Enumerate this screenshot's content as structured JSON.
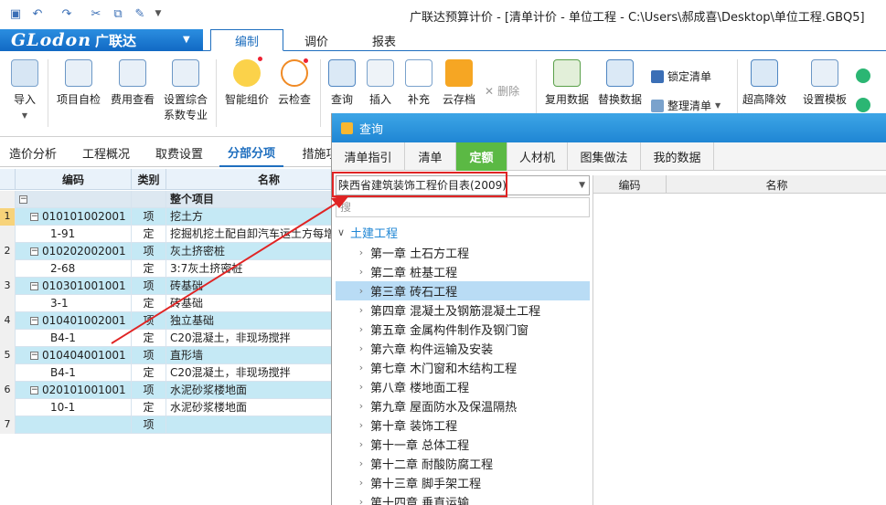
{
  "window": {
    "title": "广联达预算计价 - [清单计价 - 单位工程 - C:\\Users\\郝成喜\\Desktop\\单位工程.GBQ5]"
  },
  "logo": {
    "brand": "GLodon",
    "cn": "广联达"
  },
  "menu": {
    "tabs": [
      "编制",
      "调价",
      "报表"
    ],
    "active": 0
  },
  "ribbon": {
    "buttons": [
      "导入",
      "项目自检",
      "费用查看",
      "设置综合",
      "智能组价",
      "云检查",
      "查询",
      "插入",
      "补充",
      "云存档",
      "复用数据",
      "替换数据",
      "超高降效",
      "设置模板"
    ],
    "btn_second_line": {
      "set_compound": "系数专业"
    },
    "small": {
      "delete": "删除",
      "lock": "锁定清单",
      "organize": "整理清单"
    }
  },
  "left": {
    "tabs": [
      "造价分析",
      "工程概况",
      "取费设置",
      "分部分项",
      "措施项"
    ],
    "active_tab": 3,
    "columns": [
      "编码",
      "类别",
      "名称"
    ],
    "top_row": "整个项目",
    "rows": [
      {
        "num": "1",
        "code": "010101002001",
        "type": "项",
        "name": "挖土方",
        "kind": "item"
      },
      {
        "num": "",
        "code": "1-91",
        "type": "定",
        "name": "挖掘机挖土配自卸汽车运土方每增",
        "kind": "ding"
      },
      {
        "num": "2",
        "code": "010202002001",
        "type": "项",
        "name": "灰土挤密桩",
        "kind": "item"
      },
      {
        "num": "",
        "code": "2-68",
        "type": "定",
        "name": "3:7灰土挤密桩",
        "kind": "ding"
      },
      {
        "num": "3",
        "code": "010301001001",
        "type": "项",
        "name": "砖基础",
        "kind": "item"
      },
      {
        "num": "",
        "code": "3-1",
        "type": "定",
        "name": "砖基础",
        "kind": "ding"
      },
      {
        "num": "4",
        "code": "010401002001",
        "type": "项",
        "name": "独立基础",
        "kind": "item"
      },
      {
        "num": "",
        "code": "B4-1",
        "type": "定",
        "name": "C20混凝土，非现场搅拌",
        "kind": "ding"
      },
      {
        "num": "5",
        "code": "010404001001",
        "type": "项",
        "name": "直形墙",
        "kind": "item"
      },
      {
        "num": "",
        "code": "B4-1",
        "type": "定",
        "name": "C20混凝土，非现场搅拌",
        "kind": "ding"
      },
      {
        "num": "6",
        "code": "020101001001",
        "type": "项",
        "name": "水泥砂浆楼地面",
        "kind": "item"
      },
      {
        "num": "",
        "code": "10-1",
        "type": "定",
        "name": "水泥砂浆楼地面",
        "kind": "ding"
      },
      {
        "num": "7",
        "code": "",
        "type": "项",
        "name": "",
        "kind": "item"
      }
    ]
  },
  "dialog": {
    "title": "查询",
    "tabs": [
      "清单指引",
      "清单",
      "定额",
      "人材机",
      "图集做法",
      "我的数据"
    ],
    "active_tab": 2,
    "selected_table": "陕西省建筑装饰工程价目表(2009)",
    "search_placeholder": "搜",
    "tree_root": "土建工程",
    "chapters": [
      "第一章 土石方工程",
      "第二章 桩基工程",
      "第三章 砖石工程",
      "第四章 混凝土及钢筋混凝土工程",
      "第五章 金属构件制作及钢门窗",
      "第六章 构件运输及安装",
      "第七章 木门窗和木结构工程",
      "第八章 楼地面工程",
      "第九章 屋面防水及保温隔热",
      "第十章 装饰工程",
      "第十一章 总体工程",
      "第十二章 耐酸防腐工程",
      "第十三章 脚手架工程",
      "第十四章 垂直运输"
    ],
    "selected_chapter": 2,
    "grid_columns": [
      "编码",
      "名称"
    ]
  },
  "colors": {
    "accent": "#1f6fbf",
    "item_row": "#c5e9f5",
    "highlight": "#e02424",
    "active_tab": "#5bb944"
  }
}
